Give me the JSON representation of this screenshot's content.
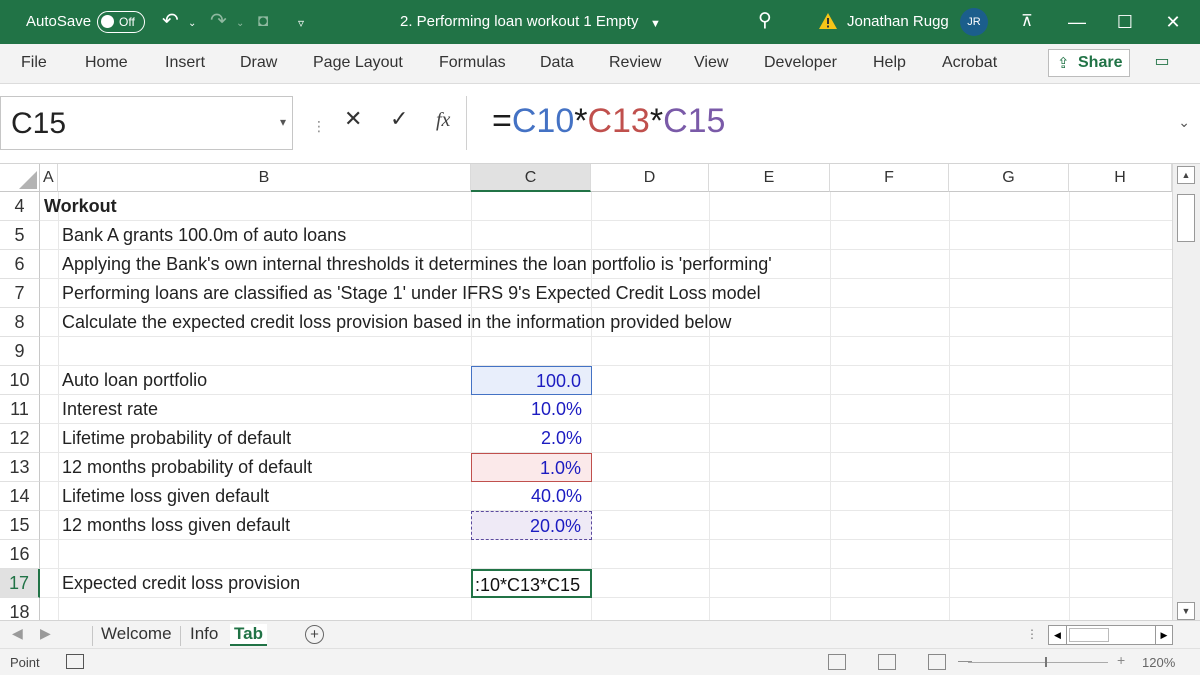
{
  "titlebar": {
    "autosave_label": "AutoSave",
    "autosave_state": "Off",
    "document_title": "2. Performing loan workout 1 Empty",
    "user_name": "Jonathan Rugg",
    "user_initials": "JR"
  },
  "ribbon": {
    "tabs": [
      "File",
      "Home",
      "Insert",
      "Draw",
      "Page Layout",
      "Formulas",
      "Data",
      "Review",
      "View",
      "Developer",
      "Help",
      "Acrobat"
    ],
    "share_label": "Share"
  },
  "formula_bar": {
    "name_box": "C15",
    "fx_label": "fx",
    "formula_parts": [
      {
        "text": "=",
        "color": "#1c1c1c"
      },
      {
        "text": "C10",
        "color": "#4472c4"
      },
      {
        "text": "*",
        "color": "#1c1c1c"
      },
      {
        "text": "C13",
        "color": "#c0504d"
      },
      {
        "text": "*",
        "color": "#1c1c1c"
      },
      {
        "text": "C15",
        "color": "#7a5aa8"
      }
    ]
  },
  "columns": [
    "A",
    "B",
    "C",
    "D",
    "E",
    "F",
    "G",
    "H"
  ],
  "rows": [
    {
      "num": "4",
      "a": "Workout",
      "b": "",
      "c": ""
    },
    {
      "num": "5",
      "a": "",
      "b": "Bank A grants 100.0m of auto loans",
      "c": ""
    },
    {
      "num": "6",
      "a": "",
      "b": "Applying the Bank's own internal thresholds it determines the loan portfolio is 'performing'",
      "c": ""
    },
    {
      "num": "7",
      "a": "",
      "b": "Performing loans are classified as 'Stage 1' under IFRS 9's Expected Credit Loss model",
      "c": ""
    },
    {
      "num": "8",
      "a": "",
      "b": "Calculate the expected credit loss provision based in the information provided below",
      "c": ""
    },
    {
      "num": "9",
      "a": "",
      "b": "",
      "c": ""
    },
    {
      "num": "10",
      "a": "",
      "b": "Auto loan portfolio",
      "c": "100.0"
    },
    {
      "num": "11",
      "a": "",
      "b": "Interest rate",
      "c": "10.0%"
    },
    {
      "num": "12",
      "a": "",
      "b": "Lifetime probability of default",
      "c": "2.0%"
    },
    {
      "num": "13",
      "a": "",
      "b": "12 months probability of default",
      "c": "1.0%"
    },
    {
      "num": "14",
      "a": "",
      "b": "Lifetime loss given default",
      "c": "40.0%"
    },
    {
      "num": "15",
      "a": "",
      "b": "12 months loss given default",
      "c": "20.0%"
    },
    {
      "num": "16",
      "a": "",
      "b": "",
      "c": ""
    },
    {
      "num": "17",
      "a": "",
      "b": "Expected credit loss provision",
      "c": ":10*C13*C15"
    },
    {
      "num": "18",
      "a": "",
      "b": "",
      "c": ""
    }
  ],
  "sheet_tabs": [
    "Welcome",
    "Info",
    "Tab"
  ],
  "active_sheet": "Tab",
  "status": {
    "mode": "Point",
    "zoom": "120%"
  }
}
